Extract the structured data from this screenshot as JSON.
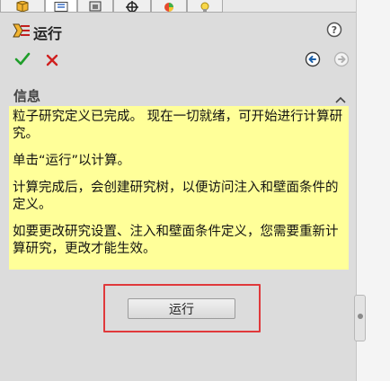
{
  "panel": {
    "title": "运行",
    "help_icon": "help-icon",
    "title_icon": "flow-run-icon"
  },
  "actions": {
    "ok_icon": "checkmark-icon",
    "cancel_icon": "close-icon",
    "back_icon": "back-arrow-icon",
    "forward_icon": "forward-arrow-icon"
  },
  "tabs": [
    {
      "icon": "part-icon"
    },
    {
      "icon": "property-manager-icon",
      "active": true
    },
    {
      "icon": "configuration-icon"
    },
    {
      "icon": "crosshair-icon"
    },
    {
      "icon": "appearance-icon"
    },
    {
      "icon": "lightbulb-icon"
    }
  ],
  "info": {
    "group_title": "信息",
    "paragraphs": [
      "粒子研究定义已完成。 现在一切就绪，可开始进行计算研究。",
      "单击“运行”以计算。",
      "计算完成后，会创建研究树，以便访问注入和壁面条件的定义。",
      "如要更改研究设置、注入和壁面条件定义，您需要重新计算研究，更改才能生效。"
    ]
  },
  "run_button": {
    "label": "运行"
  },
  "colors": {
    "info_background": "#ffff99",
    "highlight_border": "#e0393b",
    "ok_green": "#1f9e2a",
    "cancel_red": "#d0201f"
  }
}
